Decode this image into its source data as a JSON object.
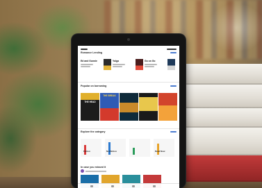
{
  "screen": {
    "section1": {
      "title": "Romance Lending",
      "items": [
        {
          "label": "Ed and Gunnie",
          "cover_color": "#2b2b2b",
          "accent": "#e4b43a"
        },
        {
          "label": "Yolga",
          "cover_color": "#4a1d1d",
          "accent": "#e24b3b"
        },
        {
          "label": "Go on Go",
          "cover_color": "#1f3a5a",
          "accent": "#d8d8d8"
        }
      ]
    },
    "section2": {
      "title": "Popular on borrowing",
      "covers": [
        {
          "title": "THE HEAD",
          "base": "#1c1c1c",
          "stripe": "#e1b02c",
          "text_color": "#ffffff"
        },
        {
          "title": "THE BREAK",
          "base": "#2e5bb5",
          "stripe": "#d33a2c",
          "text_color": "#ffd84a"
        },
        {
          "title": "",
          "base": "#0f2a3a",
          "stripe": "#c98a2a",
          "text_color": "#ffffff"
        },
        {
          "title": "",
          "base": "#1a1a1a",
          "stripe": "#e8c74c",
          "text_color": "#ffffff"
        },
        {
          "title": "",
          "base": "#d2442c",
          "stripe": "#f3a23a",
          "text_color": "#ffffff"
        }
      ]
    },
    "section3": {
      "title": "Explore the category",
      "tiles": [
        {
          "label": "Fiction",
          "bar": "#d93a3a"
        },
        {
          "label": "Nonfiction",
          "bar": "#2c7ad0"
        },
        {
          "label": "",
          "bar": "#2a9c5a"
        },
        {
          "label": "Read Now",
          "bar": "#e8a42a"
        }
      ]
    },
    "section4": {
      "title": "In case you missed it",
      "covers": [
        {
          "color": "#1a6ea8"
        },
        {
          "color": "#e1a52b"
        },
        {
          "color": "#2a8f9c"
        },
        {
          "color": "#c43a3a"
        }
      ]
    }
  }
}
